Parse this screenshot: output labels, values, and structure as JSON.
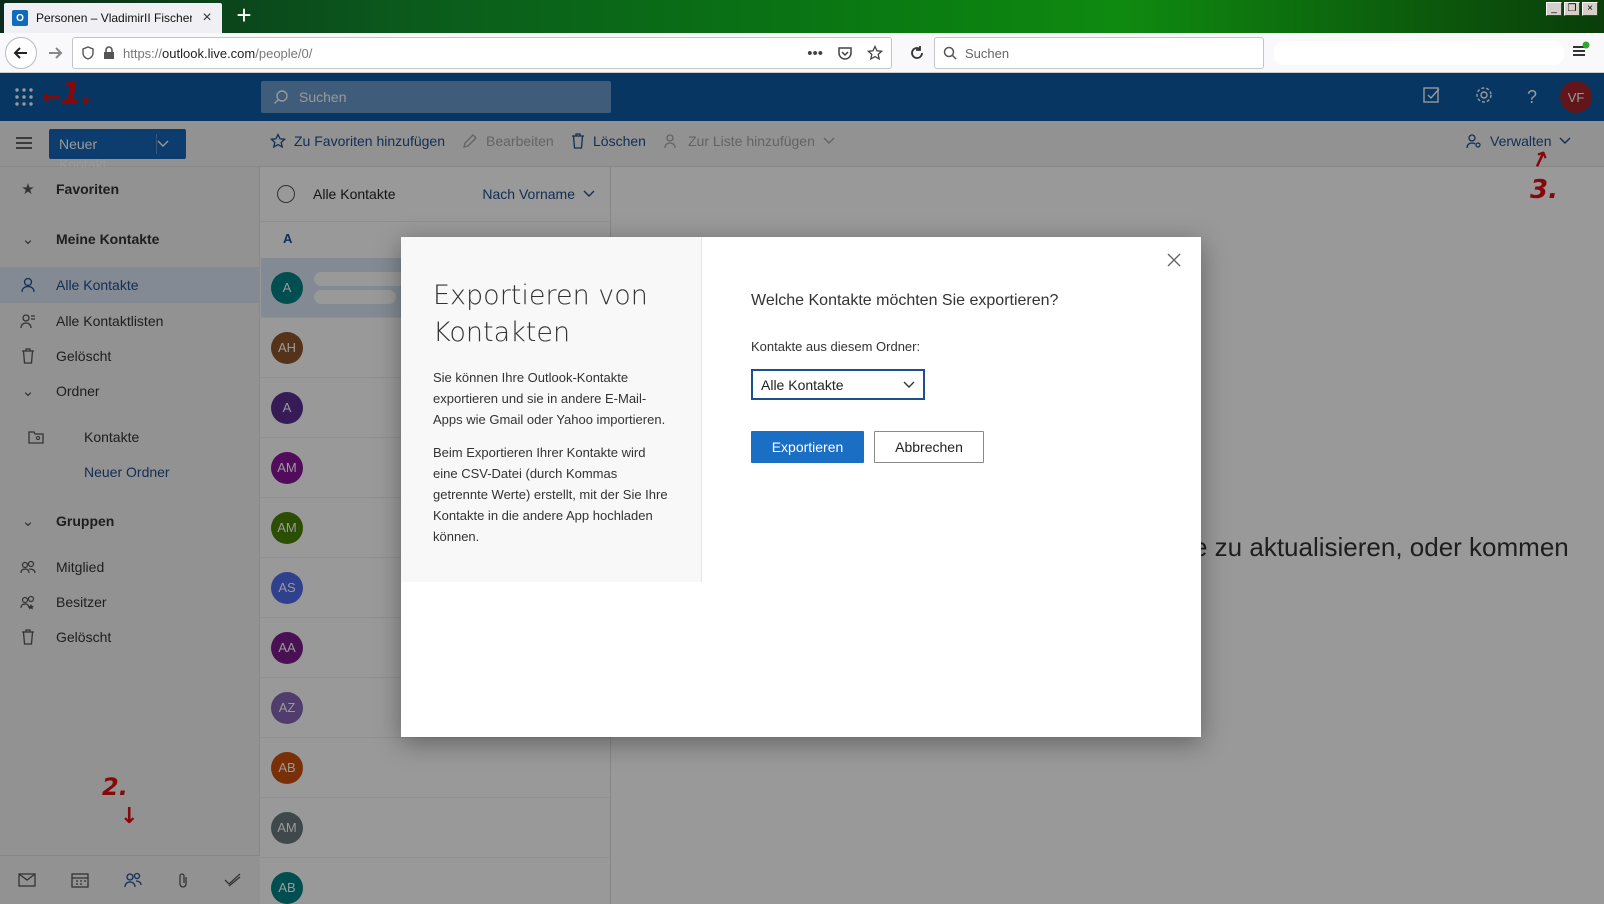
{
  "browser": {
    "tab_title": "Personen – VladimirII Fischer – Ou",
    "url_prefix": "https://",
    "url_host": "outlook.live.com",
    "url_path": "/people/0/",
    "search_placeholder": "Suchen",
    "new_tab_label": "+",
    "close_label": "×",
    "win_buttons": [
      "_",
      "❐",
      "×"
    ]
  },
  "header": {
    "search_placeholder": "Suchen",
    "avatar_initials": "VF",
    "accent": "#0c5aa6"
  },
  "commandbar": {
    "new_contact": "Neuer Kontakt",
    "favorite": "Zu Favoriten hinzufügen",
    "edit": "Bearbeiten",
    "delete": "Löschen",
    "add_to_list": "Zur Liste hinzufügen",
    "manage": "Verwalten"
  },
  "sidebar": {
    "favorites": "Favoriten",
    "my_contacts": "Meine Kontakte",
    "all_contacts": "Alle Kontakte",
    "all_lists": "Alle Kontaktlisten",
    "deleted": "Gelöscht",
    "folders": "Ordner",
    "contacts_folder": "Kontakte",
    "new_folder": "Neuer Ordner",
    "groups": "Gruppen",
    "member": "Mitglied",
    "owner": "Besitzer",
    "groups_deleted": "Gelöscht"
  },
  "contactlist": {
    "title": "Alle Kontakte",
    "sort": "Nach Vorname",
    "letter": "A",
    "contacts": [
      {
        "initials": "A",
        "color": "#038387"
      },
      {
        "initials": "AH",
        "color": "#8e562e"
      },
      {
        "initials": "A",
        "color": "#5c2e91"
      },
      {
        "initials": "AM",
        "color": "#881798"
      },
      {
        "initials": "AM",
        "color": "#498205"
      },
      {
        "initials": "AS",
        "color": "#4f6bed"
      },
      {
        "initials": "AA",
        "color": "#7a1b8a"
      },
      {
        "initials": "AZ",
        "color": "#8764b8"
      },
      {
        "initials": "AB",
        "color": "#ca5010"
      },
      {
        "initials": "AM",
        "color": "#69797e"
      },
      {
        "initials": "AB",
        "color": "#038387"
      }
    ]
  },
  "reading_pane": {
    "text": "ite zu aktualisieren, oder kommen"
  },
  "dialog": {
    "title": "Exportieren von Kontakten",
    "para1": "Sie können Ihre Outlook-Kontakte exportieren und sie in andere E-Mail-Apps wie Gmail oder Yahoo importieren.",
    "para2": "Beim Exportieren Ihrer Kontakte wird eine CSV-Datei (durch Kommas getrennte Werte) erstellt, mit der Sie Ihre Kontakte in die andere App hochladen können.",
    "question": "Welche Kontakte möchten Sie exportieren?",
    "folder_label": "Kontakte aus diesem Ordner:",
    "folder_value": "Alle Kontakte",
    "export_button": "Exportieren",
    "cancel_button": "Abbrechen"
  },
  "annotations": [
    "1.",
    "2.",
    "3."
  ]
}
